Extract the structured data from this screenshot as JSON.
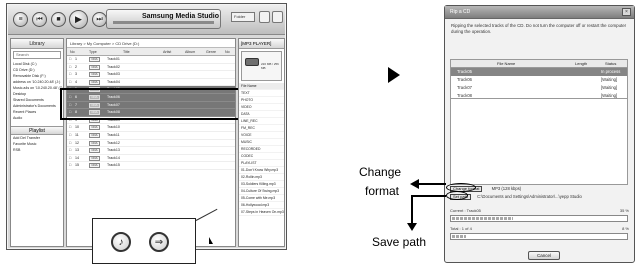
{
  "media_studio": {
    "app_title": "Samsung Media Studio",
    "lcd_box": "Folder",
    "library": {
      "header": "Library",
      "search_placeholder": "Search",
      "items": [
        "Local Disk (C:)",
        "CD Drive (D:)",
        "Removable Disk (F:)",
        "address on '10.240.20.48' (J:)",
        "Music.a4s on '10.240.20.48' (Z:)",
        "Desktop",
        "Shared Documents",
        "Administrator's Documents",
        "Recent Places",
        "Audio"
      ],
      "playlist_header": "Playlist",
      "playlist_toolbar": [
        "Add",
        "Del",
        "Transfer"
      ],
      "playlist_items": [
        "Favorite Music",
        "RSB"
      ]
    },
    "tracks": {
      "breadcrumb": "Library > My Computer > CD Drive (D:)",
      "columns": [
        "No",
        "Type",
        "Title",
        "Artist",
        "Album",
        "Genre",
        "No"
      ],
      "format_label": "CDA",
      "rows": [
        {
          "no": "1",
          "title": "Track01",
          "selected": false
        },
        {
          "no": "2",
          "title": "Track02",
          "selected": false
        },
        {
          "no": "3",
          "title": "Track03",
          "selected": false
        },
        {
          "no": "4",
          "title": "Track04",
          "selected": false
        },
        {
          "no": "5",
          "title": "Track05",
          "selected": true
        },
        {
          "no": "6",
          "title": "Track06",
          "selected": true
        },
        {
          "no": "7",
          "title": "Track07",
          "selected": true
        },
        {
          "no": "8",
          "title": "Track08",
          "selected": true
        },
        {
          "no": "9",
          "title": "Track09",
          "selected": false
        },
        {
          "no": "10",
          "title": "Track10",
          "selected": false
        },
        {
          "no": "11",
          "title": "Track11",
          "selected": false
        },
        {
          "no": "12",
          "title": "Track12",
          "selected": false
        },
        {
          "no": "13",
          "title": "Track13",
          "selected": false
        },
        {
          "no": "14",
          "title": "Track14",
          "selected": false
        },
        {
          "no": "15",
          "title": "Track15",
          "selected": false
        }
      ]
    },
    "device": {
      "header": "[MP3 PLAYER]",
      "capacity": "220 MB / 256 MB",
      "list_header": "File Name",
      "folders": [
        "TEXT",
        "PHOTO",
        "VIDEO",
        "DATA",
        "LINE_REC",
        "FM_REC",
        "VOICE",
        "MUSIC",
        "RECORDED",
        "CODEC",
        "PLAYLIST"
      ],
      "files": [
        "01-Don't Know Why.mp3",
        "02-Rollin.mp3",
        "03-Soldiers Killing.mp3",
        "04-Culture Of Swing.mp3",
        "05-Come with Me.mp3",
        "06-Hollywood.mp3",
        "07-Steps in Heaven On.mp3"
      ]
    },
    "callout_icons": [
      "rip-cd-icon",
      "transfer-icon"
    ]
  },
  "rip_dialog": {
    "title": "Rip a CD",
    "instructions": "Ripping the selected tracks of the CD. Do not turn the computer off or restart the computer during the operation.",
    "columns": [
      "File Name",
      "Length",
      "Status"
    ],
    "rows": [
      {
        "name": "Track05",
        "length": "",
        "status": "In process",
        "active": true
      },
      {
        "name": "Track06",
        "length": "",
        "status": "[Waiting]",
        "active": false
      },
      {
        "name": "Track07",
        "length": "",
        "status": "[Waiting]",
        "active": false
      },
      {
        "name": "Track08",
        "length": "",
        "status": "[Waiting]",
        "active": false
      }
    ],
    "change_format_button": "Change format",
    "format_value": "MP3 (128 kbps)",
    "set_path_button": "Set path",
    "path_value": "C:\\Documents and Settings\\Administrator\\...\\yepp Studio",
    "current_label": "Current : Track05",
    "current_pct": "35 %",
    "current_progress": 0.35,
    "total_label": "Total : 1 of 4",
    "total_pct": "8 %",
    "total_progress": 0.08,
    "cancel_button": "Cancel"
  },
  "annotations": {
    "change_format_line1": "Change",
    "change_format_line2": "format",
    "save_path": "Save path"
  }
}
